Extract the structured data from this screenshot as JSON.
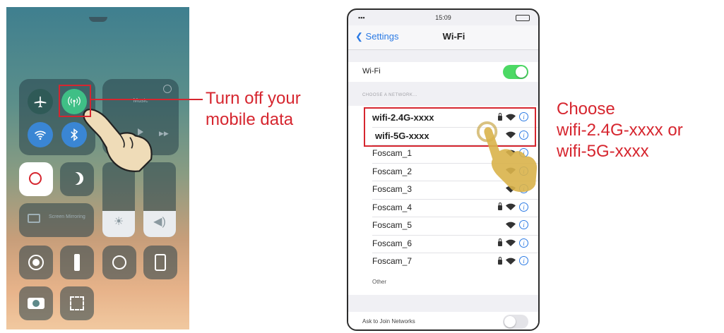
{
  "control_center": {
    "brightness_level": 0.35,
    "volume_level": 0.35,
    "mirroring_label": "Screen Mirroring",
    "media_label": "Music"
  },
  "callouts": {
    "mobile_data": [
      "Turn off your",
      "mobile data"
    ],
    "choose_network": [
      "Choose",
      "wifi-2.4G-xxxx or",
      "wifi-5G-xxxx"
    ]
  },
  "settings": {
    "status_bar": {
      "time": "15:09"
    },
    "back_label": "Settings",
    "title": "Wi-Fi",
    "wifi_label": "Wi-Fi",
    "wifi_on": true,
    "section_header": "CHOOSE A NETWORK...",
    "networks": [
      {
        "name": "wifi-2.4G-xxxx",
        "locked": true,
        "highlighted": true
      },
      {
        "name": "wifi-5G-xxxx",
        "locked": false,
        "highlighted": true
      },
      {
        "name": "Foscam_1",
        "locked": false
      },
      {
        "name": "Foscam_2",
        "locked": false
      },
      {
        "name": "Foscam_3",
        "locked": false
      },
      {
        "name": "Foscam_4",
        "locked": true
      },
      {
        "name": "Foscam_5",
        "locked": false
      },
      {
        "name": "Foscam_6",
        "locked": true
      },
      {
        "name": "Foscam_7",
        "locked": true
      }
    ],
    "other_label": "Other",
    "ask_to_join_label": "Ask to Join Networks",
    "ask_to_join_on": false
  },
  "colors": {
    "accent_red": "#d6262f",
    "ios_blue": "#2b7ae4",
    "toggle_green": "#4cd964"
  }
}
